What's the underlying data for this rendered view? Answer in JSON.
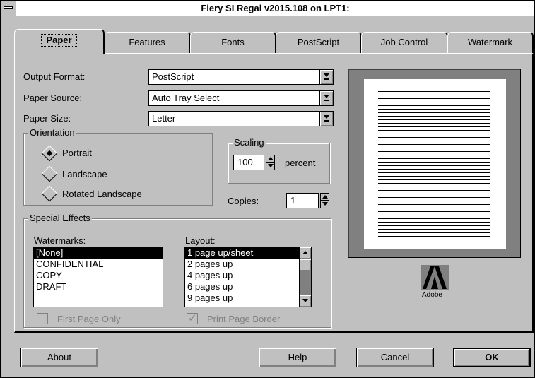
{
  "window": {
    "title": "Fiery SI Regal v2015.108 on LPT1:"
  },
  "tabs": [
    {
      "label": "Paper",
      "active": true
    },
    {
      "label": "Features"
    },
    {
      "label": "Fonts"
    },
    {
      "label": "PostScript"
    },
    {
      "label": "Job Control"
    },
    {
      "label": "Watermark"
    }
  ],
  "fields": {
    "output_format": {
      "label": "Output Format:",
      "value": "PostScript"
    },
    "paper_source": {
      "label": "Paper Source:",
      "value": "Auto Tray Select"
    },
    "paper_size": {
      "label": "Paper Size:",
      "value": "Letter"
    }
  },
  "orientation": {
    "label": "Orientation",
    "options": [
      "Portrait",
      "Landscape",
      "Rotated Landscape"
    ],
    "selected": "Portrait"
  },
  "scaling": {
    "label": "Scaling",
    "value": "100",
    "unit": "percent"
  },
  "copies": {
    "label": "Copies:",
    "value": "1"
  },
  "special_effects": {
    "label": "Special Effects",
    "watermarks_label": "Watermarks:",
    "watermarks": [
      "[None]",
      "CONFIDENTIAL",
      "COPY",
      "DRAFT"
    ],
    "watermarks_selected": "[None]",
    "layout_label": "Layout:",
    "layouts": [
      "1 page up/sheet",
      "2 pages up",
      "4 pages up",
      "6 pages up",
      "9 pages up"
    ],
    "layout_selected": "1 page up/sheet",
    "first_page_only": {
      "label": "First Page Only",
      "checked": false,
      "enabled": false
    },
    "print_page_border": {
      "label": "Print Page Border",
      "checked": true,
      "enabled": false
    }
  },
  "preview": {
    "logo_text": "Adobe"
  },
  "buttons": {
    "about": "About",
    "help": "Help",
    "cancel": "Cancel",
    "ok": "OK"
  },
  "colors": {
    "face": "#c0c0c0",
    "shadow": "#808080",
    "highlight": "#ffffff",
    "selection": "#000000"
  }
}
